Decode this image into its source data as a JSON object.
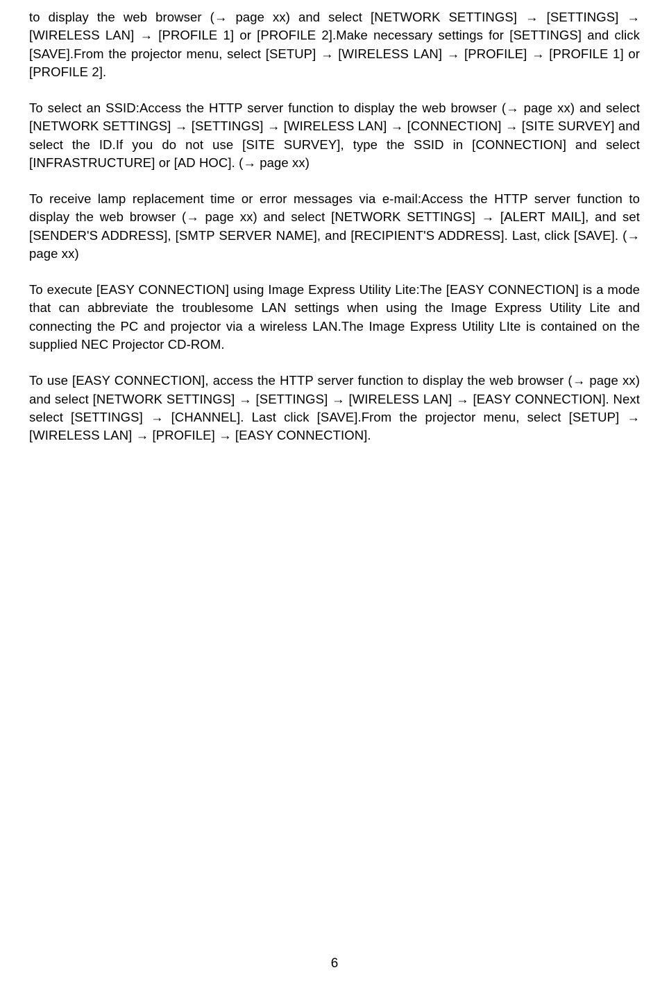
{
  "paragraphs": [
    "to display the web browser (→ page xx) and select [NETWORK SETTINGS] → [SETTINGS] → [WIRELESS LAN] → [PROFILE 1] or [PROFILE 2].Make necessary settings for [SETTINGS] and click [SAVE].From the projector menu, select [SETUP] → [WIRELESS LAN] → [PROFILE] → [PROFILE 1] or [PROFILE 2].",
    "To select an SSID:Access the HTTP server function to display the web browser (→ page xx) and select [NETWORK SETTINGS] → [SETTINGS] → [WIRELESS LAN] → [CONNECTION] → [SITE SURVEY] and select the ID.If you do not use [SITE SURVEY], type the SSID in [CONNECTION] and select [INFRASTRUCTURE] or [AD HOC]. (→ page xx)",
    "To receive lamp replacement time or error messages via e-mail:Access the HTTP server function to display the web browser (→ page xx) and select [NETWORK SETTINGS] → [ALERT MAIL], and set [SENDER'S ADDRESS], [SMTP SERVER NAME], and [RECIPIENT'S ADDRESS]. Last, click [SAVE]. (→ page xx)",
    "To execute [EASY CONNECTION] using Image Express Utility Lite:The [EASY CONNECTION] is a mode that can abbreviate the troublesome LAN settings when using the Image Express Utility Lite and connecting the PC and projector via a wireless LAN.The Image Express Utility LIte is contained on the supplied NEC Projector CD-ROM.",
    "To use [EASY CONNECTION], access the HTTP server function to display the web browser (→ page xx) and select [NETWORK SETTINGS] → [SETTINGS] → [WIRELESS LAN] → [EASY CONNECTION]. Next select [SETTINGS] → [CHANNEL]. Last click [SAVE].From the projector menu, select [SETUP] → [WIRELESS LAN] → [PROFILE] → [EASY CONNECTION]."
  ],
  "pageNumber": "6"
}
